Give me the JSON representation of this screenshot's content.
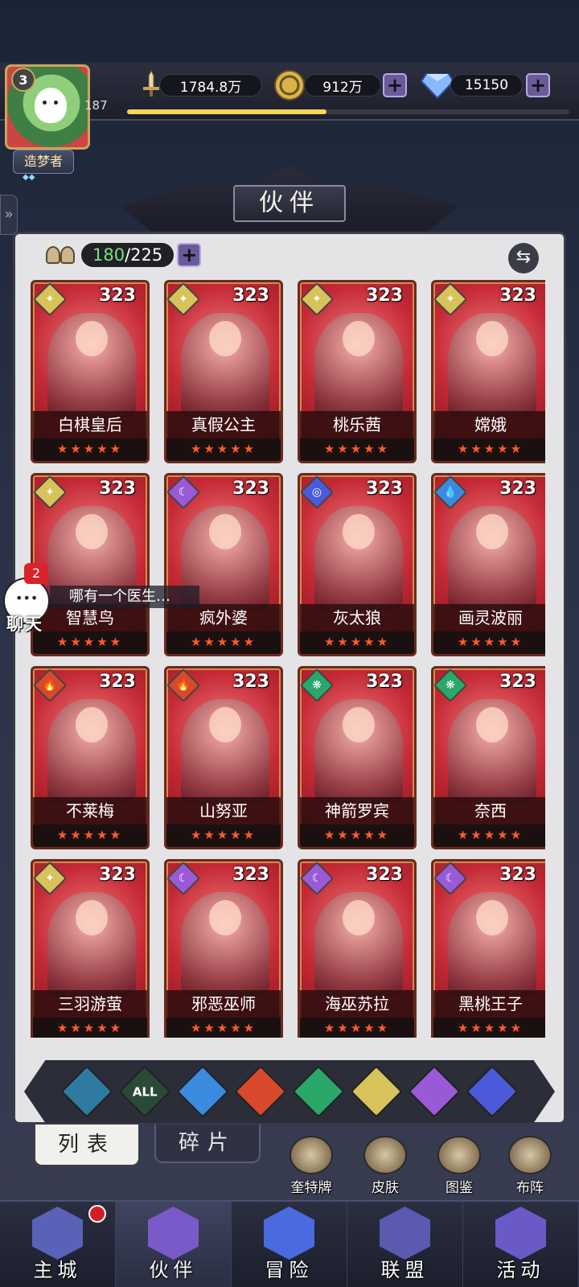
{
  "player": {
    "level": "3",
    "xp_number": "187",
    "xp_progress": 0.45,
    "title": "造梦者",
    "title_stars": "◆◆"
  },
  "resources": {
    "power": "1784.8万",
    "gold": "912万",
    "gems": "15150"
  },
  "page": {
    "title": "伙伴"
  },
  "roster": {
    "current": "180",
    "max": "/225"
  },
  "chat": {
    "count": "2",
    "label": "聊天",
    "message": "哪有一个医生…"
  },
  "cards": [
    {
      "name": "白棋皇后",
      "level": "323",
      "faction": "light",
      "stars": "★★★★★"
    },
    {
      "name": "真假公主",
      "level": "323",
      "faction": "light",
      "stars": "★★★★★"
    },
    {
      "name": "桃乐茜",
      "level": "323",
      "faction": "light",
      "stars": "★★★★★"
    },
    {
      "name": "嫦娥",
      "level": "323",
      "faction": "light",
      "stars": "★★★★★"
    },
    {
      "name": "智慧鸟",
      "level": "323",
      "faction": "light",
      "stars": "★★★★★"
    },
    {
      "name": "疯外婆",
      "level": "323",
      "faction": "dark",
      "stars": "★★★★★"
    },
    {
      "name": "灰太狼",
      "level": "323",
      "faction": "space",
      "stars": "★★★★★"
    },
    {
      "name": "画灵波丽",
      "level": "323",
      "faction": "water",
      "stars": "★★★★★"
    },
    {
      "name": "不莱梅",
      "level": "323",
      "faction": "fire",
      "stars": "★★★★★"
    },
    {
      "name": "山努亚",
      "level": "323",
      "faction": "fire",
      "stars": "★★★★★"
    },
    {
      "name": "神箭罗宾",
      "level": "323",
      "faction": "wind",
      "stars": "★★★★★"
    },
    {
      "name": "奈西",
      "level": "323",
      "faction": "wind",
      "stars": "★★★★★"
    },
    {
      "name": "三羽游萤",
      "level": "323",
      "faction": "light",
      "stars": "★★★★★"
    },
    {
      "name": "邪恶巫师",
      "level": "323",
      "faction": "dark",
      "stars": "★★★★★"
    },
    {
      "name": "海巫苏拉",
      "level": "323",
      "faction": "dark",
      "stars": "★★★★★"
    },
    {
      "name": "黑桃王子",
      "level": "323",
      "faction": "dark",
      "stars": "★★★★★"
    }
  ],
  "faction_colors": {
    "light": "#d8c25a",
    "dark": "#9a5ad8",
    "space": "#4a5ad8",
    "water": "#3a8ae0",
    "fire": "#d8482a",
    "wind": "#2aa86a"
  },
  "filters": [
    {
      "icon": "arrow-up-icon",
      "label": "",
      "color": "#2f7aa0"
    },
    {
      "icon": "all-icon",
      "label": "ALL",
      "color": "#2a4a38"
    },
    {
      "icon": "water-icon",
      "label": "",
      "color": "#3a8ae0"
    },
    {
      "icon": "fire-icon",
      "label": "",
      "color": "#d8482a"
    },
    {
      "icon": "wind-icon",
      "label": "",
      "color": "#2aa86a"
    },
    {
      "icon": "light-icon",
      "label": "",
      "color": "#d8c25a"
    },
    {
      "icon": "dark-icon",
      "label": "",
      "color": "#9a5ad8"
    },
    {
      "icon": "space-icon",
      "label": "",
      "color": "#4a5ad8"
    }
  ],
  "tabs": {
    "list": "列表",
    "fragments": "碎片"
  },
  "functions": [
    {
      "label": "奎特牌"
    },
    {
      "label": "皮肤"
    },
    {
      "label": "图鉴"
    },
    {
      "label": "布阵"
    }
  ],
  "nav": [
    {
      "label": "主城",
      "color": "#5a62b8"
    },
    {
      "label": "伙伴",
      "color": "#7a5ac8"
    },
    {
      "label": "冒险",
      "color": "#4a6ae0"
    },
    {
      "label": "联盟",
      "color": "#5a5ab0"
    },
    {
      "label": "活动",
      "color": "#6a5ac8"
    }
  ]
}
